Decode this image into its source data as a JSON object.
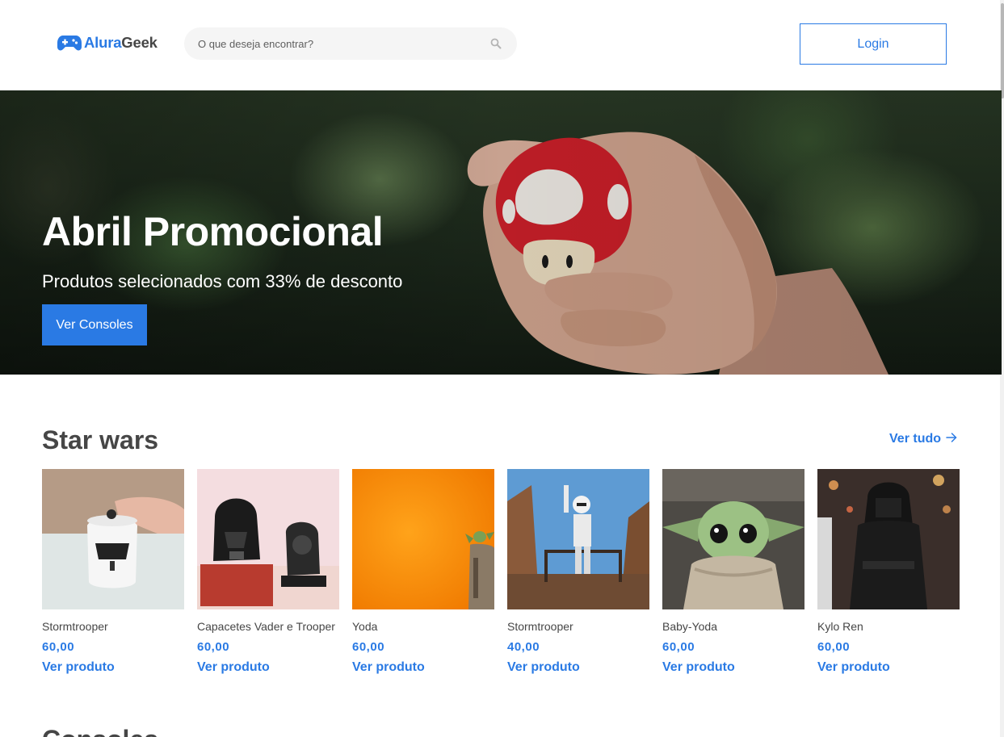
{
  "colors": {
    "accent": "#2A7AE4",
    "text": "#464646",
    "search_bg": "#f5f5f5"
  },
  "header": {
    "logo": {
      "icon": "gamepad-icon",
      "part1": "Alura",
      "part2": "Geek"
    },
    "search": {
      "placeholder": "O que deseja encontrar?",
      "value": "",
      "icon": "search-icon"
    },
    "login_label": "Login"
  },
  "hero": {
    "title": "Abril Promocional",
    "subtitle": "Produtos selecionados com 33% de desconto",
    "button_label": "Ver Consoles"
  },
  "section": {
    "title": "Star wars",
    "see_all_label": "Ver tudo",
    "see_all_icon": "arrow-right-icon",
    "products": [
      {
        "name": "Stormtrooper",
        "price": "60,00",
        "link": "Ver produto"
      },
      {
        "name": "Capacetes Vader e Trooper",
        "price": "60,00",
        "link": "Ver produto"
      },
      {
        "name": "Yoda",
        "price": "60,00",
        "link": "Ver produto"
      },
      {
        "name": "Stormtrooper",
        "price": "40,00",
        "link": "Ver produto"
      },
      {
        "name": "Baby-Yoda",
        "price": "60,00",
        "link": "Ver produto"
      },
      {
        "name": "Kylo Ren",
        "price": "60,00",
        "link": "Ver produto"
      }
    ]
  },
  "next_section": {
    "title": "Consoles"
  }
}
